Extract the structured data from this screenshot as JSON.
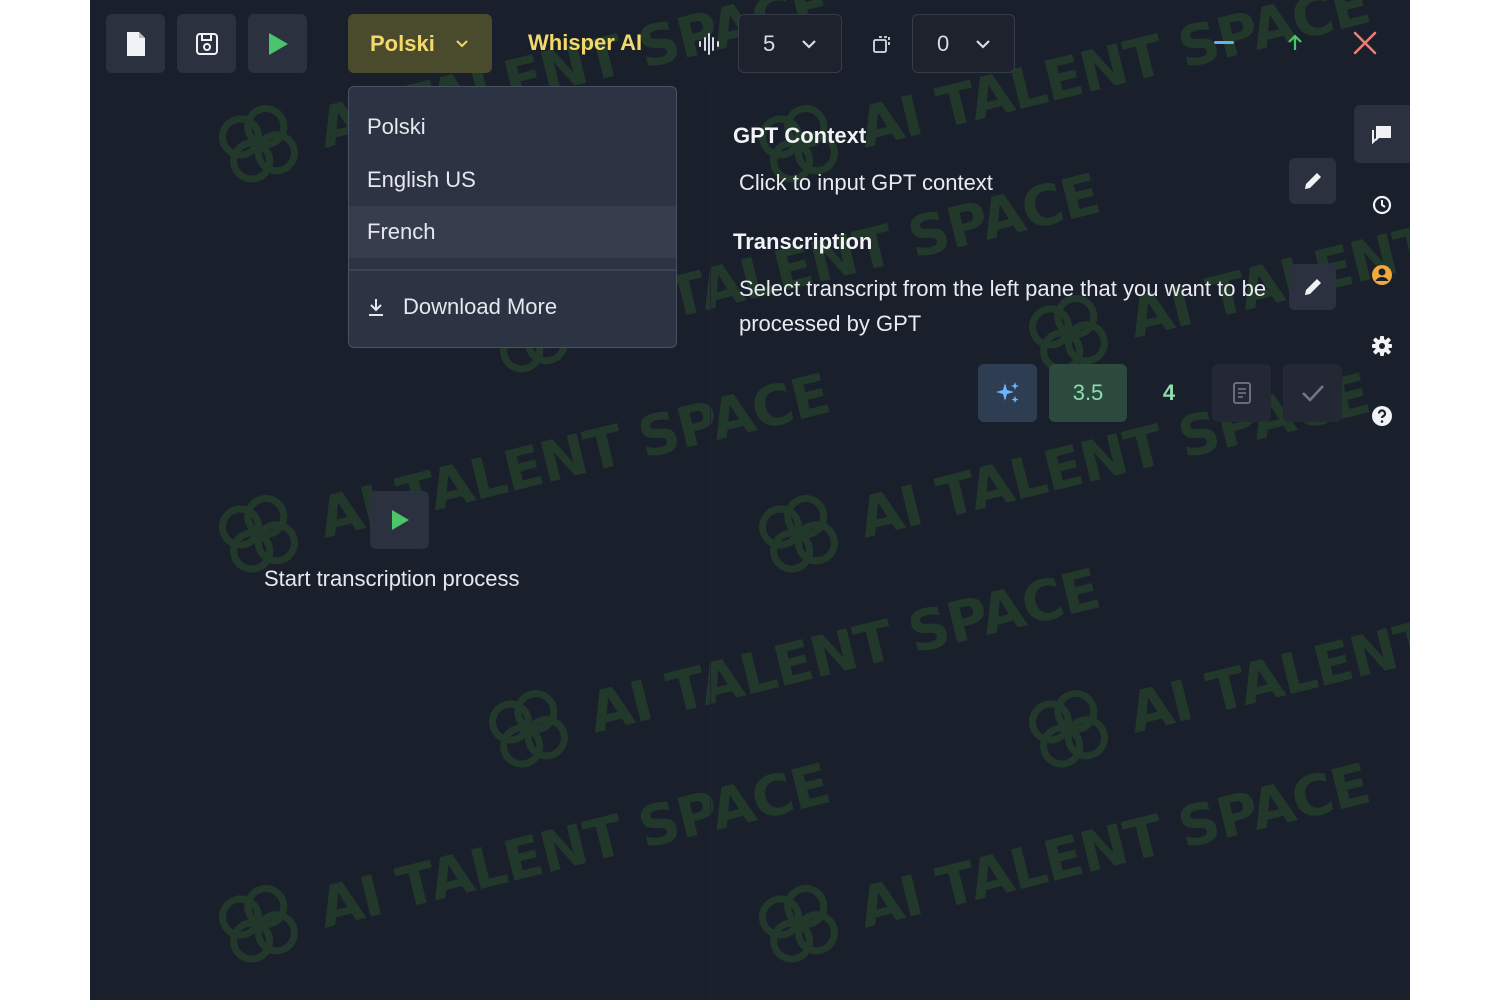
{
  "toolbar": {
    "language_selected": "Polski",
    "model_label": "Whisper AI",
    "count_select_value": "5",
    "offset_select_value": "0"
  },
  "language_dropdown": {
    "options": [
      "Polski",
      "English US",
      "French"
    ],
    "highlighted": "French",
    "download_more_label": "Download More"
  },
  "left_pane": {
    "start_label": "Start transcription process"
  },
  "right_pane": {
    "gpt_context_title": "GPT Context",
    "gpt_context_placeholder": "Click to input GPT context",
    "transcription_title": "Transcription",
    "transcription_placeholder": "Select transcript from the left pane that you want to be processed by GPT",
    "model_options": [
      "3.5",
      "4"
    ]
  },
  "watermark": {
    "text": "AI TALENT SPACE"
  },
  "colors": {
    "background": "#1a1f2c",
    "accent_yellow": "#f2d96a",
    "accent_green": "#4cc46b",
    "close_red": "#f07a74",
    "minimize_blue": "#5fb6e6",
    "watermark_green": "#22382b"
  },
  "icons": {
    "new_file": "file-icon",
    "save": "save-icon",
    "run": "play-icon",
    "audio": "waveform-icon",
    "copy": "copy-icon",
    "minimize": "minimize-icon",
    "restore": "arrow-up-icon",
    "close": "close-icon",
    "chat": "chat-icon",
    "history": "history-icon",
    "user": "user-icon",
    "settings": "gear-icon",
    "help": "help-icon",
    "sparkle": "sparkle-icon",
    "document": "document-icon",
    "check": "check-icon",
    "edit": "pencil-icon",
    "download": "download-icon"
  }
}
